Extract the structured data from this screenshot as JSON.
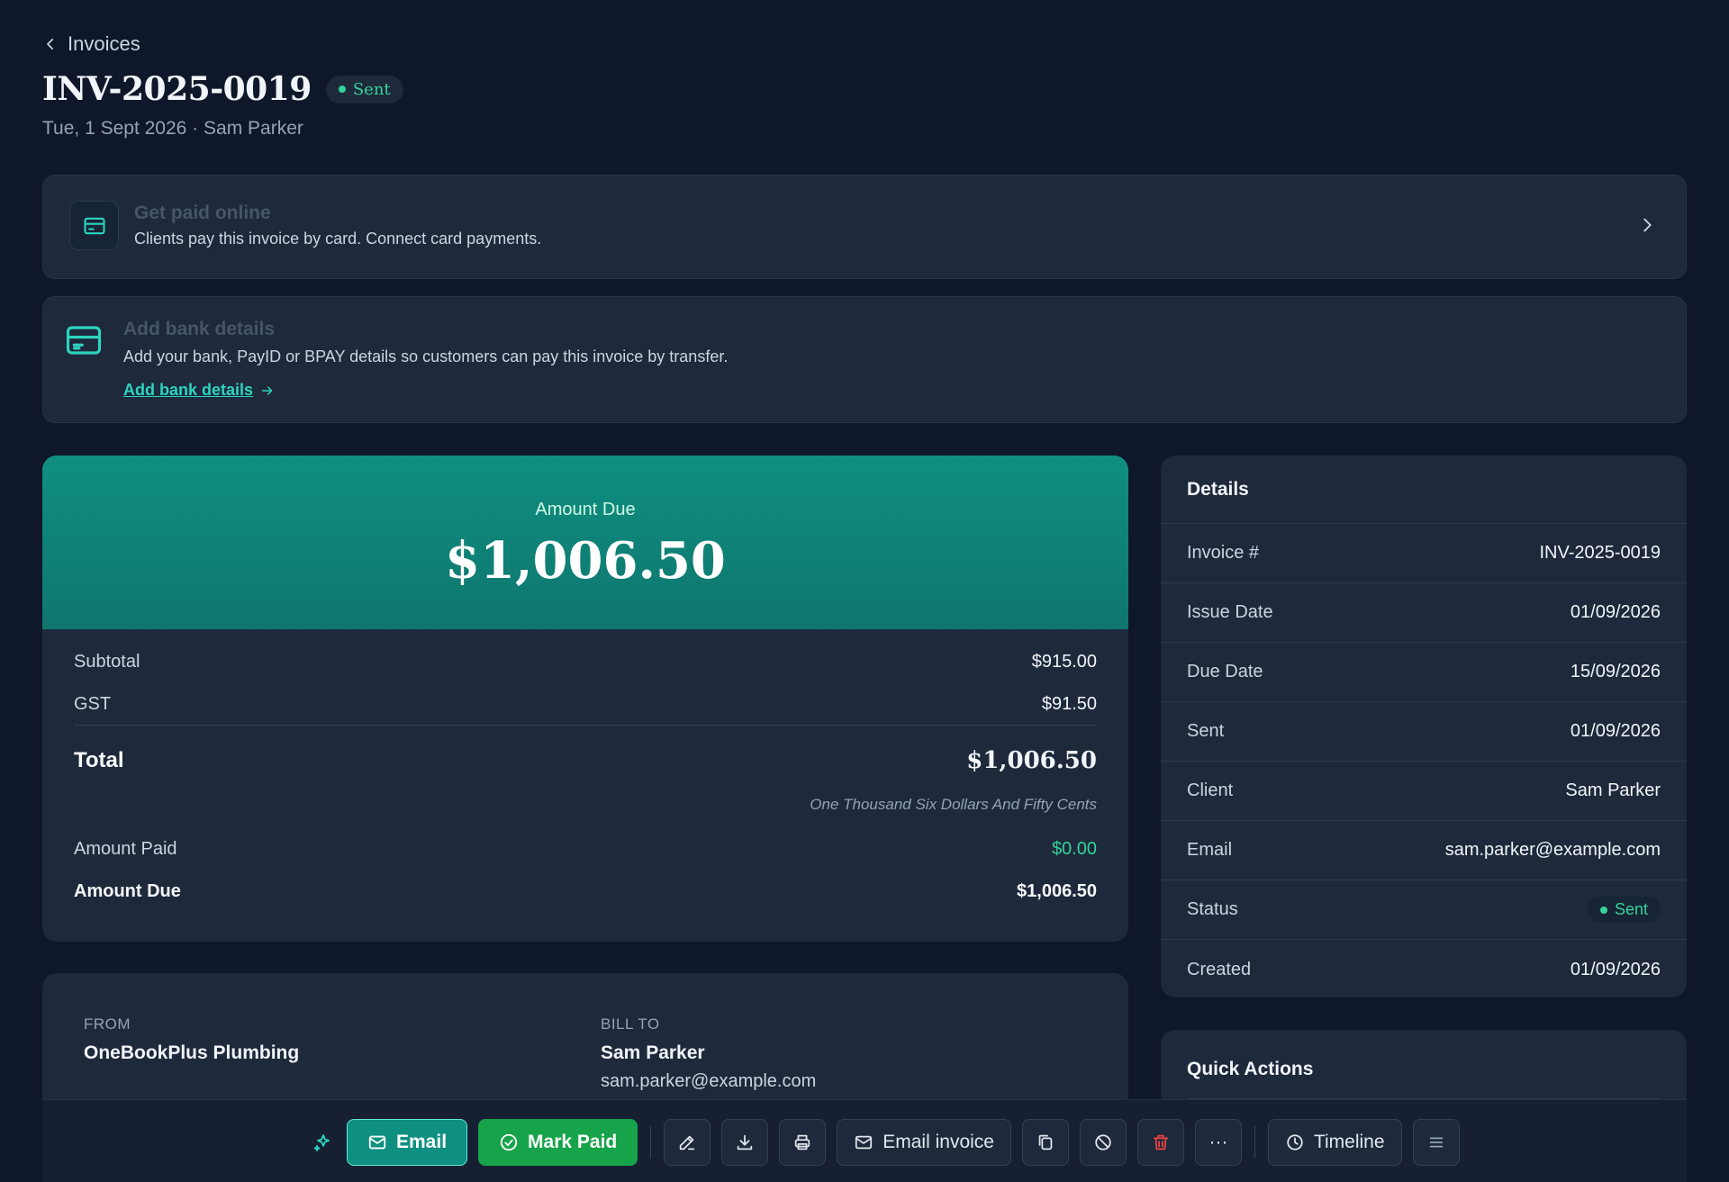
{
  "header": {
    "back_label": "Invoices",
    "title": "INV-2025-0019",
    "status": "Sent",
    "subtitle": "Tue, 1 Sept 2026 · Sam Parker"
  },
  "banners": {
    "online": {
      "title": "Get paid online",
      "description": "Clients pay this invoice by card. Connect card payments."
    },
    "bank": {
      "title": "Add bank details",
      "description": "Add your bank, PayID or BPAY details so customers can pay this invoice by transfer.",
      "link": "Add bank details"
    }
  },
  "amount": {
    "hero_label": "Amount Due",
    "hero_value": "$1,006.50",
    "subtotal_label": "Subtotal",
    "subtotal_value": "$915.00",
    "gst_label": "GST",
    "gst_value": "$91.50",
    "total_label": "Total",
    "total_value": "$1,006.50",
    "total_words": "One Thousand Six Dollars And Fifty Cents",
    "paid_label": "Amount Paid",
    "paid_value": "$0.00",
    "due_label": "Amount Due",
    "due_value": "$1,006.50"
  },
  "parties": {
    "from_label": "FROM",
    "from_name": "OneBookPlus Plumbing",
    "to_label": "BILL TO",
    "to_name": "Sam Parker",
    "to_email": "sam.parker@example.com"
  },
  "details": {
    "title": "Details",
    "rows": [
      {
        "label": "Invoice #",
        "value": "INV-2025-0019"
      },
      {
        "label": "Issue Date",
        "value": "01/09/2026"
      },
      {
        "label": "Due Date",
        "value": "15/09/2026"
      },
      {
        "label": "Sent",
        "value": "01/09/2026"
      },
      {
        "label": "Client",
        "value": "Sam Parker"
      },
      {
        "label": "Email",
        "value": "sam.parker@example.com"
      },
      {
        "label": "Status",
        "value": "Sent"
      },
      {
        "label": "Created",
        "value": "01/09/2026"
      }
    ]
  },
  "quick_actions": {
    "title": "Quick Actions"
  },
  "toolbar": {
    "email_label": "Email",
    "mark_paid_label": "Mark Paid",
    "email_invoice_label": "Email invoice",
    "timeline_label": "Timeline",
    "more_label": "···",
    "icons": [
      "sparkle-icon",
      "mail-icon",
      "check-circle-icon",
      "edit-icon",
      "download-icon",
      "print-icon",
      "mail-icon",
      "copy-icon",
      "ban-icon",
      "trash-icon",
      "more-icon",
      "clock-icon",
      "menu-icon"
    ]
  },
  "colors": {
    "background": "#0f172a",
    "card": "#1e293b",
    "accent": "#0f8f80",
    "success": "#16a34a",
    "status_green": "#34d399",
    "danger": "#ef4444"
  }
}
